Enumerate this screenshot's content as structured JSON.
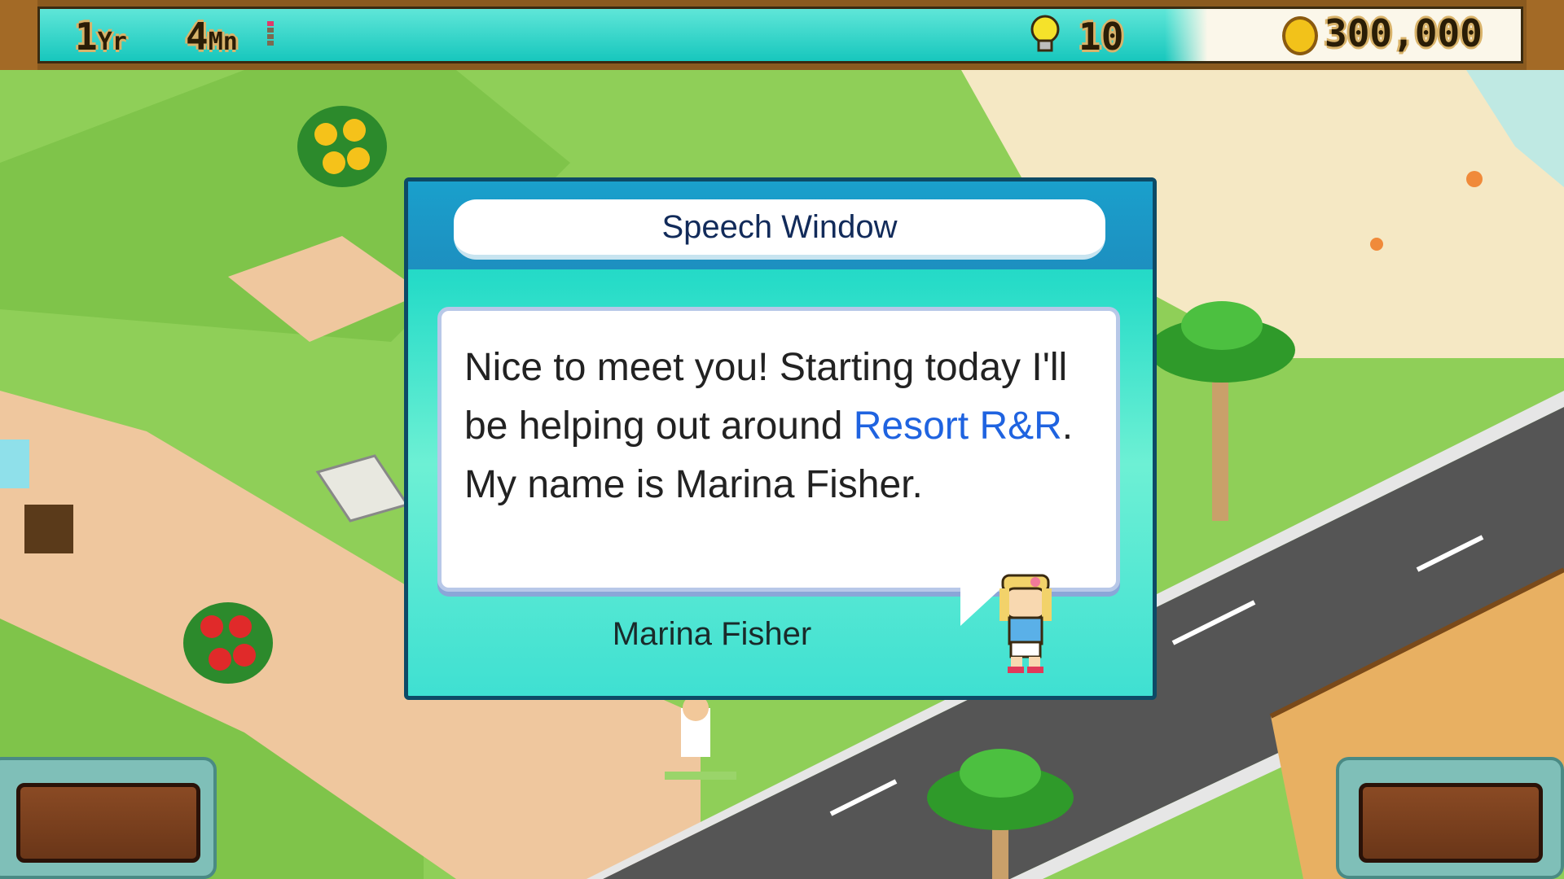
{
  "hud": {
    "year_value": "1",
    "year_unit": "Yr",
    "month_value": "4",
    "month_unit": "Mn",
    "month_progress_segments_filled": 1,
    "month_progress_segments_total": 4,
    "ideas_count": "10",
    "money": "300,000"
  },
  "dialog": {
    "title": "Speech Window",
    "message_parts": [
      {
        "text": "Nice to meet you! Starting today I'll be helping out around ",
        "highlight": false
      },
      {
        "text": "Resort R&R",
        "highlight": true
      },
      {
        "text": ". My name is Marina Fisher.",
        "highlight": false
      }
    ],
    "speaker": "Marina Fisher",
    "highlight_color": "#1f63e0"
  },
  "icons": {
    "ideas": "lightbulb-icon",
    "money": "coin-icon",
    "portrait": "marina-portrait"
  },
  "colors": {
    "hud_bar": "#17c7bd",
    "dialog_teal": "#27dcc8",
    "dialog_header": "#1d8fc0",
    "frame_brown": "#8a5a1f",
    "road": "#555555",
    "grass": "#8fcf58",
    "sand": "#f5e8c4"
  }
}
